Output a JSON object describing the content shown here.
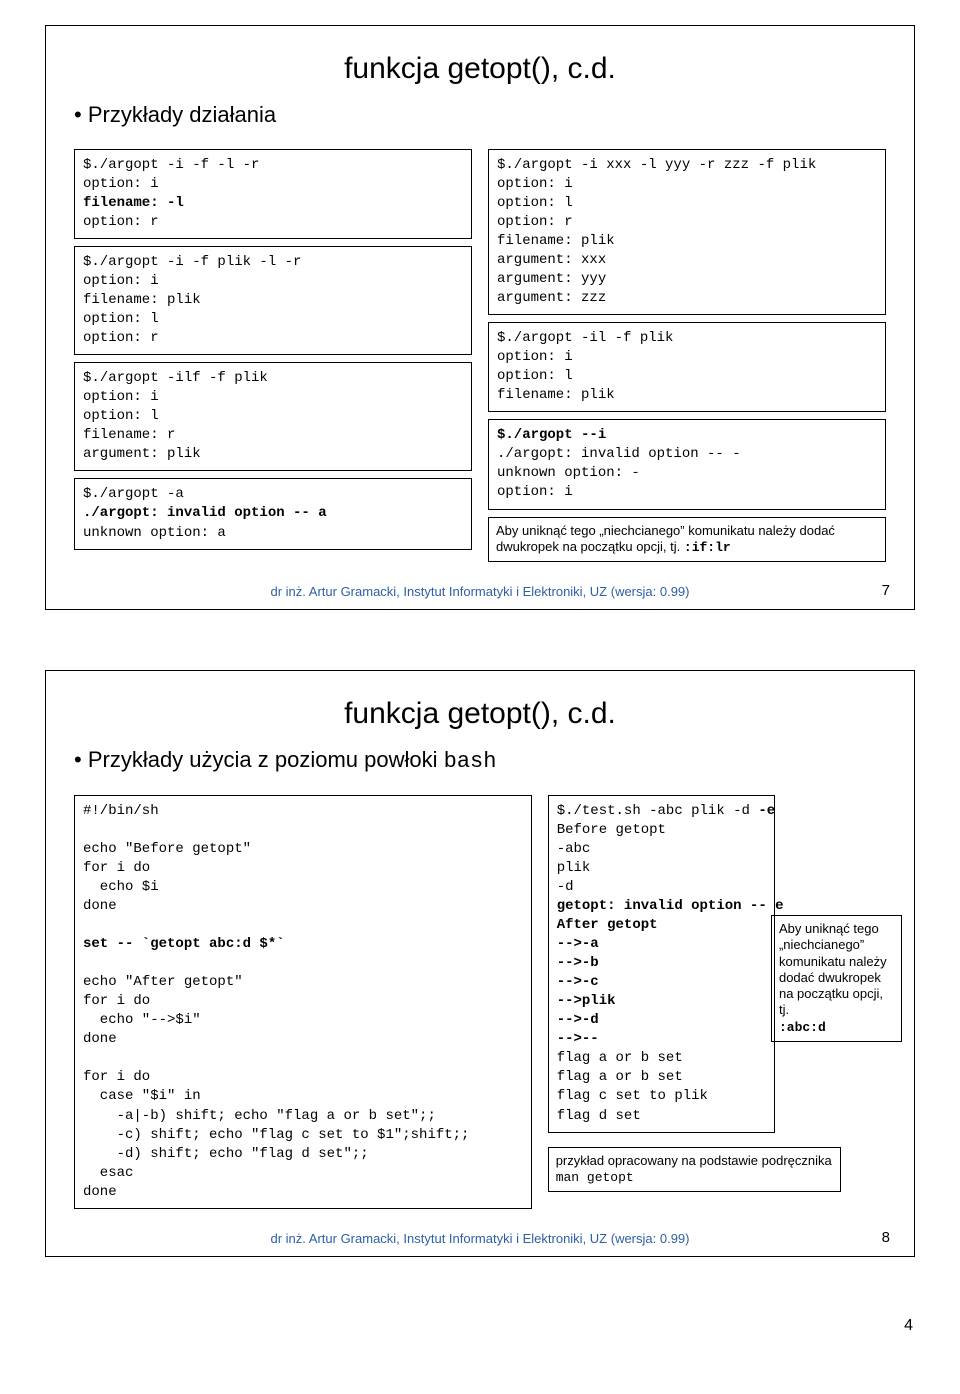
{
  "slide7": {
    "title": "funkcja getopt(), c.d.",
    "bullet": "Przykłady działania",
    "leftBoxes": [
      "$./argopt -i -f -l -r\noption: i\nfilename: -l\noption: r",
      "$./argopt -i -f plik -l -r\noption: i\nfilename: plik\noption: l\noption: r",
      "$./argopt -ilf -f plik\noption: i\noption: l\nfilename: r\nargument: plik",
      "$./argopt -a\n./argopt: invalid option -- a\nunknown option: a"
    ],
    "leftBox0_line3": "filename: -l",
    "leftBox3_line2": "./argopt: invalid option -- a",
    "rightBoxes": [
      "$./argopt -i xxx -l yyy -r zzz -f plik\noption: i\noption: l\noption: r\nfilename: plik\nargument: xxx\nargument: yyy\nargument: zzz",
      "$./argopt -il -f plik\noption: i\noption: l\nfilename: plik",
      "$./argopt --i\n./argopt: invalid option -- -\nunknown option: -\noption: i"
    ],
    "rightBox2_line1": "$./argopt --i",
    "note": "Aby uniknąć tego „niechcianego” komunikatu należy dodać dwukropek na początku opcji, tj. ",
    "note_code": ":if:lr",
    "footer": "dr inż. Artur Gramacki, Instytut Informatyki i Elektroniki, UZ (wersja: 0.99)",
    "pagenum": "7"
  },
  "slide8": {
    "title": "funkcja getopt(), c.d.",
    "bullet": "Przykłady użycia z poziomu powłoki ",
    "bullet_code": "bash",
    "leftCode": "#!/bin/sh\n\necho \"Before getopt\"\nfor i do\n  echo $i\ndone\n\nset -- `getopt abc:d $*`\n\necho \"After getopt\"\nfor i do\n  echo \"-->$i\"\ndone\n\nfor i do\n  case \"$i\" in\n    -a|-b) shift; echo \"flag a or b set\";;\n    -c) shift; echo \"flag c set to $1\";shift;;\n    -d) shift; echo \"flag d set\";;\n  esac\ndone",
    "setLine": "set -- `getopt abc:d $*`",
    "rightCode_pre": "$./test.sh -abc plik -d ",
    "rightCode_bold_e": "-e",
    "rightCode_mid1": "\nBefore getopt\n-abc\nplik\n-d\n",
    "rightCode_boldblock": "getopt: invalid option -- e\nAfter getopt\n-->-a\n-->-b\n-->-c\n-->plik\n-->-d\n-->--",
    "rightCode_mid2": "\nflag a or b set\nflag a or b set\nflag c set to plik\nflag d set",
    "note1": "Aby uniknąć tego „niechcianego” komunikatu należy dodać dwukropek na początku opcji, tj.",
    "note1_code": ":abc:d",
    "note2": "przykład opracowany na podstawie podręcznika ",
    "note2_code": "man getopt",
    "footer": "dr inż. Artur Gramacki, Instytut Informatyki i Elektroniki, UZ (wersja: 0.99)",
    "pagenum": "8"
  },
  "outerPage": "4"
}
